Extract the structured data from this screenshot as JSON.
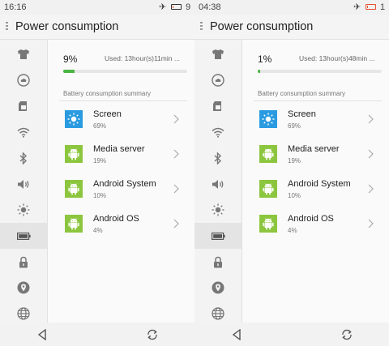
{
  "panes": [
    {
      "status": {
        "time": "16:16",
        "battery_level": "9"
      },
      "title": "Power consumption",
      "summary": {
        "percent": "9%",
        "used": "Used: 13hour(s)11min ...",
        "progress_fraction": 0.09
      },
      "section_header": "Battery consumption summary",
      "apps": [
        {
          "name": "Screen",
          "value": "69%",
          "icon": "screen-brightness-icon"
        },
        {
          "name": "Media server",
          "value": "19%",
          "icon": "android-icon"
        },
        {
          "name": "Android System",
          "value": "10%",
          "icon": "android-icon"
        },
        {
          "name": "Android OS",
          "value": "4%",
          "icon": "android-icon"
        }
      ]
    },
    {
      "status": {
        "time": "04:38",
        "battery_level": "1"
      },
      "title": "Power consumption",
      "summary": {
        "percent": "1%",
        "used": "Used: 13hour(s)48min ...",
        "progress_fraction": 0.01
      },
      "section_header": "Battery consumption summary",
      "apps": [
        {
          "name": "Screen",
          "value": "69%",
          "icon": "screen-brightness-icon"
        },
        {
          "name": "Media server",
          "value": "19%",
          "icon": "android-icon"
        },
        {
          "name": "Android System",
          "value": "10%",
          "icon": "android-icon"
        },
        {
          "name": "Android OS",
          "value": "4%",
          "icon": "android-icon"
        }
      ]
    }
  ],
  "sidebar_icons": [
    "theme-shirt-icon",
    "cloud-icon",
    "sim-card-icon",
    "wifi-icon",
    "bluetooth-icon",
    "volume-icon",
    "brightness-icon",
    "battery-icon",
    "lock-icon",
    "location-icon",
    "globe-icon"
  ],
  "sidebar_selected": "battery-icon",
  "navbar_icons": [
    "back-icon",
    "recents-icon"
  ],
  "colors": {
    "accent_green": "#4bb543",
    "android_green": "#8cc63f",
    "screen_blue": "#2a9be0",
    "battery_warning": "#e8512e"
  }
}
